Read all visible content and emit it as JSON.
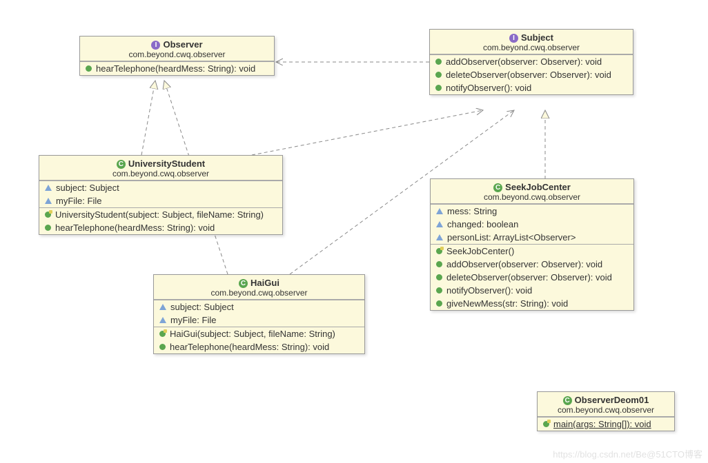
{
  "watermark": "https://blog.csdn.net/Be@51CTO博客",
  "classes": {
    "observer": {
      "stereotype": "I",
      "name": "Observer",
      "pkg": "com.beyond.cwq.observer",
      "methods": [
        "hearTelephone(heardMess: String): void"
      ]
    },
    "subject": {
      "stereotype": "I",
      "name": "Subject",
      "pkg": "com.beyond.cwq.observer",
      "methods": [
        "addObserver(observer: Observer): void",
        "deleteObserver(observer: Observer): void",
        "notifyObserver(): void"
      ]
    },
    "universityStudent": {
      "stereotype": "C",
      "name": "UniversityStudent",
      "pkg": "com.beyond.cwq.observer",
      "fields": [
        "subject: Subject",
        "myFile: File"
      ],
      "ctor": "UniversityStudent(subject: Subject, fileName: String)",
      "methods": [
        "hearTelephone(heardMess: String): void"
      ]
    },
    "haiGui": {
      "stereotype": "C",
      "name": "HaiGui",
      "pkg": "com.beyond.cwq.observer",
      "fields": [
        "subject: Subject",
        "myFile: File"
      ],
      "ctor": "HaiGui(subject: Subject, fileName: String)",
      "methods": [
        "hearTelephone(heardMess: String): void"
      ]
    },
    "seekJobCenter": {
      "stereotype": "C",
      "name": "SeekJobCenter",
      "pkg": "com.beyond.cwq.observer",
      "fields": [
        "mess: String",
        "changed: boolean",
        "personList: ArrayList<Observer>"
      ],
      "ctor": "SeekJobCenter()",
      "methods": [
        "addObserver(observer: Observer): void",
        "deleteObserver(observer: Observer): void",
        "notifyObserver(): void",
        "giveNewMess(str: String): void"
      ]
    },
    "observerDeom01": {
      "stereotype": "C",
      "name": "ObserverDeom01",
      "pkg": "com.beyond.cwq.observer",
      "mainMethod": "main(args: String[]): void"
    }
  }
}
